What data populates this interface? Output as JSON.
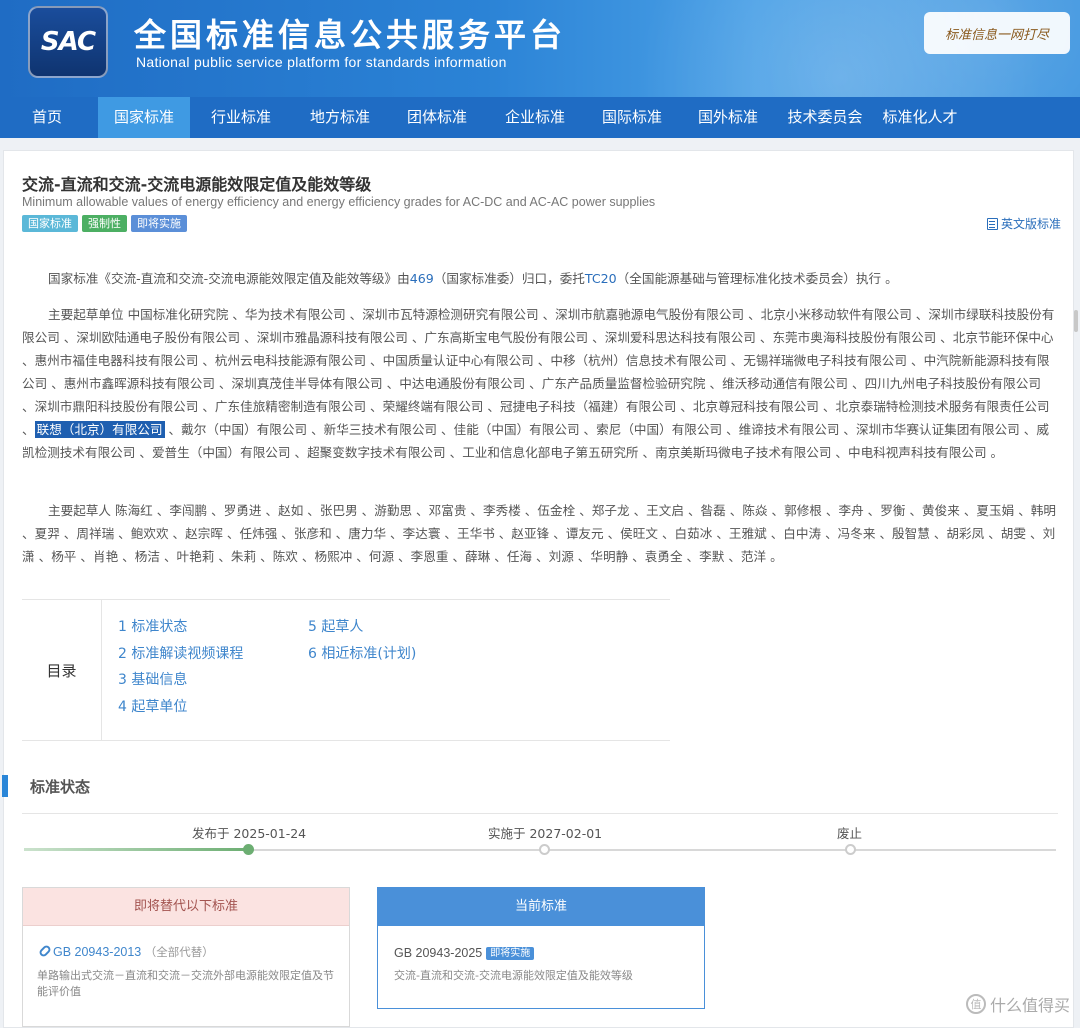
{
  "header": {
    "logo_text": "SAC",
    "title": "全国标准信息公共服务平台",
    "subtitle": "National public service platform  for standards information",
    "slogan": "标准信息一网打尽"
  },
  "nav": {
    "items": [
      "首页",
      "国家标准",
      "行业标准",
      "地方标准",
      "团体标准",
      "企业标准",
      "国际标准",
      "国外标准",
      "技术委员会",
      "标准化人才"
    ],
    "active_index": 1
  },
  "standard": {
    "title": "交流-直流和交流-交流电源能效限定值及能效等级",
    "title_en": "Minimum allowable values of energy efficiency and energy efficiency grades for AC-DC and AC-AC power supplies",
    "tags": [
      "国家标准",
      "强制性",
      "即将实施"
    ],
    "english_link": "英文版标准"
  },
  "intro": {
    "p1_a": "国家标准《交流-直流和交流-交流电源能效限定值及能效等级》由",
    "p1_link1": "469",
    "p1_b": "（国家标准委）归口，委托",
    "p1_link2": "TC20",
    "p1_c": "（全国能源基础与管理标准化技术委员会）执行 。",
    "p2_a": "主要起草单位 中国标准化研究院 、华为技术有限公司 、深圳市瓦特源检测研究有限公司 、深圳市航嘉驰源电气股份有限公司 、北京小米移动软件有限公司 、深圳市绿联科技股份有限公司 、深圳欧陆通电子股份有限公司 、深圳市雅晶源科技有限公司 、广东高斯宝电气股份有限公司 、深圳爱科思达科技有限公司 、东莞市奥海科技股份有限公司 、北京节能环保中心 、惠州市福佳电器科技有限公司 、杭州云电科技能源有限公司 、中国质量认证中心有限公司 、中移（杭州）信息技术有限公司 、无锡祥瑞微电子科技有限公司 、中汽院新能源科技有限公司 、惠州市鑫晖源科技有限公司 、深圳真茂佳半导体有限公司 、中达电通股份有限公司 、广东产品质量监督检验研究院 、维沃移动通信有限公司 、四川九州电子科技股份有限公司 、深圳市鼎阳科技股份有限公司 、广东佳旅精密制造有限公司 、荣耀终端有限公司 、冠捷电子科技（福建）有限公司 、北京尊冠科技有限公司 、北京泰瑞特检测技术服务有限责任公司 、",
    "p2_highlight": "联想（北京）有限公司",
    "p2_b": " 、戴尔（中国）有限公司 、新华三技术有限公司 、佳能（中国）有限公司 、索尼（中国）有限公司 、维谛技术有限公司 、深圳市华赛认证集团有限公司 、威凯检测技术有限公司 、爱普生（中国）有限公司 、超聚变数字技术有限公司 、工业和信息化部电子第五研究所 、南京美斯玛微电子技术有限公司 、中电科视声科技有限公司 。",
    "p3": "主要起草人 陈海红 、李闯鹏 、罗勇进 、赵如 、张巴男 、游勤思 、邓富贵 、李秀楼 、伍金栓 、郑子龙 、王文启 、昝磊 、陈焱 、郭修根 、李舟 、罗衡 、黄俊来 、夏玉娟 、韩明 、夏羿 、周祥瑞 、鲍欢欢 、赵宗晖 、任炜强 、张彦和 、唐力华 、李达寰 、王华书 、赵亚锋 、谭友元 、侯旺文 、白茹冰 、王雅斌 、白中涛 、冯冬来 、殷智慧 、胡彩凤 、胡雯 、刘潇 、杨平 、肖艳 、杨洁 、叶艳莉 、朱莉 、陈欢 、杨熙冲 、何源 、李恩重 、薛琳 、任海 、刘源 、华明静 、袁勇全 、李默 、范洋 。"
  },
  "toc": {
    "label": "目录",
    "col1": [
      "1  标准状态",
      "2  标准解读视频课程",
      "3  基础信息",
      "4  起草单位"
    ],
    "col2": [
      "5  起草人",
      "6  相近标准(计划)"
    ]
  },
  "status": {
    "section_title": "标准状态",
    "published": "发布于 2025-01-24",
    "effective": "实施于 2027-02-01",
    "abolished": "废止",
    "progress_stage": 1
  },
  "replaces": {
    "head": "即将替代以下标准",
    "code": "GB 20943-2013",
    "scope": "（全部代替）",
    "desc": "单路输出式交流－直流和交流－交流外部电源能效限定值及节能评价值"
  },
  "current": {
    "head": "当前标准",
    "code": "GB 20943-2025",
    "badge": "即将实施",
    "desc": "交流-直流和交流-交流电源能效限定值及能效等级"
  },
  "watermark": {
    "text": "什么值得买",
    "icon": "值"
  },
  "colors": {
    "brand_blue": "#1f6cc4",
    "nav_active": "#3f9ae3",
    "link": "#2a6ebb",
    "success": "#6cae72"
  }
}
